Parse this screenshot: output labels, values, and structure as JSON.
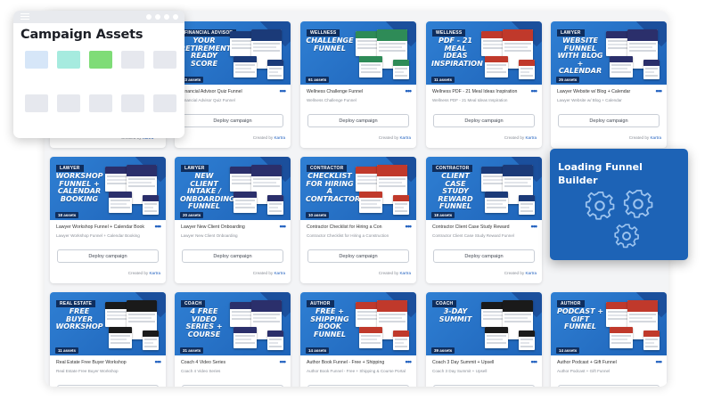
{
  "deploy_label": "Deploy campaign",
  "created_prefix": "Created by",
  "assets_panel": {
    "title": "Campaign Assets",
    "swatches": [
      "#d6e6f8",
      "#a6ebdf",
      "#7fdc77",
      "#e6e8ee",
      "#e6e8ee",
      "#e6e8ee",
      "#e6e8ee",
      "#e6e8ee",
      "#e6e8ee",
      "#e6e8ee"
    ]
  },
  "loading_card": {
    "title": "Loading Funnel Builder",
    "icons": [
      "gear-icon",
      "gear-icon",
      "gear-icon"
    ]
  },
  "colors": {
    "brand_blue": "#1d63b6",
    "tag_navy": "#0f2e5e",
    "link_blue": "#1f5fbf"
  },
  "cards": [
    {
      "tag": "FINANCIAL ADVISOR",
      "headline": "YOUR RETIREMENT READY SCORE",
      "assets": "23 assets",
      "title": "Financial Advisor Quiz Funnel",
      "subtitle": "Financial Advisor Quiz Funnel",
      "author": "Kartra",
      "shot_color": "#1b3a78"
    },
    {
      "tag": "WELLNESS",
      "headline": "CHALLENGE FUNNEL",
      "assets": "61 assets",
      "title": "Wellness Challenge Funnel",
      "subtitle": "Wellness Challenge Funnel",
      "author": "Kartra",
      "shot_color": "#2e8b57"
    },
    {
      "tag": "WELLNESS",
      "headline": "PDF - 21 MEAL IDEAS INSPIRATION",
      "assets": "11 assets",
      "title": "Wellness PDF - 21 Meal Ideas Inspiration",
      "subtitle": "Wellness PDF - 21 Meal Ideas Inspiration",
      "author": "Kartra",
      "shot_color": "#c0392b"
    },
    {
      "tag": "LAWYER",
      "headline": "WEBSITE FUNNEL WITH BLOG + CALENDAR",
      "assets": "25 assets",
      "title": "Lawyer Website w/ Blog + Calendar",
      "subtitle": "Lawyer Website w/ Blog + Calendar",
      "author": "Kartra",
      "shot_color": "#2b2f6b"
    },
    {
      "tag": "LAWYER",
      "headline": "WORKSHOP FUNNEL + CALENDAR BOOKING",
      "assets": "18 assets",
      "title": "Lawyer Workshop Funnel + Calendar Book",
      "subtitle": "Lawyer Workshop Funnel + Calendar Booking",
      "author": "Kartra",
      "shot_color": "#2b2f6b"
    },
    {
      "tag": "LAWYER",
      "headline": "NEW CLIENT INTAKE / ONBOARDING FUNNEL",
      "assets": "20 assets",
      "title": "Lawyer New Client Onboarding",
      "subtitle": "Lawyer New Client Onboarding",
      "author": "Kartra",
      "shot_color": "#2b2f6b"
    },
    {
      "tag": "CONTRACTOR",
      "headline": "CHECKLIST FOR HIRING A CONTRACTOR",
      "assets": "10 assets",
      "title": "Contractor Checklist for Hiring a Con",
      "subtitle": "Contractor Checklist for Hiring a Construction",
      "author": "Kartra",
      "shot_color": "#c0392b"
    },
    {
      "tag": "CONTRACTOR",
      "headline": "CLIENT CASE STUDY REWARD FUNNEL",
      "assets": "18 assets",
      "title": "Contractor Client Case Study Reward",
      "subtitle": "Contractor Client Case Study Reward Funnel",
      "author": "Kartra",
      "shot_color": "#1b3a78"
    },
    {
      "tag": "REAL ESTATE",
      "headline": "FREE BUYER WORKSHOP",
      "assets": "11 assets",
      "title": "Real Estate Free Buyer Workshop",
      "subtitle": "Real Estate Free Buyer Workshop",
      "author": "",
      "shot_color": "#1a1a1a"
    },
    {
      "tag": "COACH",
      "headline": "4 FREE VIDEO SERIES + COURSE",
      "assets": "31 assets",
      "title": "Coach 4 Video Series",
      "subtitle": "Coach 4 Video Series",
      "author": "",
      "shot_color": "#2b2f6b"
    },
    {
      "tag": "AUTHOR",
      "headline": "FREE + SHIPPING BOOK FUNNEL",
      "assets": "14 assets",
      "title": "Author Book Funnel - Free + Shipping",
      "subtitle": "Author Book Funnel - Free + Shipping & Course Portal",
      "author": "",
      "shot_color": "#c0392b"
    },
    {
      "tag": "COACH",
      "headline": "3-DAY SUMMIT",
      "assets": "39 assets",
      "title": "Coach 3 Day Summit + Upsell",
      "subtitle": "Coach 3 Day Summit + Upsell",
      "author": "",
      "shot_color": "#1a1a1a"
    },
    {
      "tag": "AUTHOR",
      "headline": "PODCAST + GIFT FUNNEL",
      "assets": "14 assets",
      "title": "Author Podcast + Gift Funnel",
      "subtitle": "Author Podcast + Gift Funnel",
      "author": "",
      "shot_color": "#c0392b"
    }
  ]
}
